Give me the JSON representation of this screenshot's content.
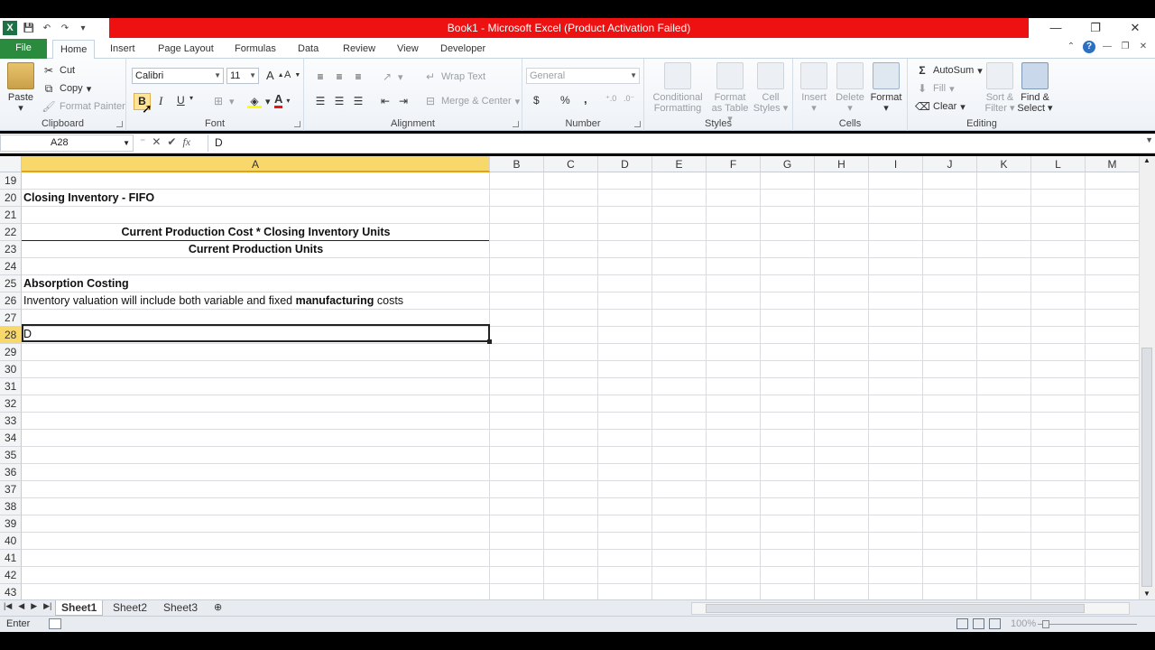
{
  "window": {
    "title": "Book1  -  Microsoft Excel (Product Activation Failed)",
    "title_bg": "#ee1111",
    "buttons": [
      "minimize",
      "restore",
      "close"
    ]
  },
  "ribbon": {
    "tabs": [
      "File",
      "Home",
      "Insert",
      "Page Layout",
      "Formulas",
      "Data",
      "Review",
      "View",
      "Developer"
    ],
    "active_tab": "Home",
    "clipboard": {
      "paste": "Paste",
      "cut": "Cut",
      "copy": "Copy",
      "format_painter": "Format Painter",
      "label": "Clipboard"
    },
    "font": {
      "name": "Calibri",
      "size": "11",
      "label": "Font",
      "bold": "B",
      "italic": "I",
      "underline": "U"
    },
    "alignment": {
      "wrap_text": "Wrap Text",
      "merge_center": "Merge & Center",
      "label": "Alignment"
    },
    "number": {
      "format": "General",
      "label": "Number",
      "currency": "$",
      "percent": "%",
      "comma": ","
    },
    "styles": {
      "conditional": "Conditional Formatting",
      "conditional_l1": "Conditional",
      "conditional_l2": "Formatting",
      "table_l1": "Format",
      "table_l2": "as Table",
      "cell_l1": "Cell",
      "cell_l2": "Styles",
      "label": "Styles"
    },
    "cells": {
      "insert": "Insert",
      "delete": "Delete",
      "format": "Format",
      "label": "Cells"
    },
    "editing": {
      "autosum": "AutoSum",
      "fill": "Fill",
      "clear": "Clear",
      "sort_l1": "Sort &",
      "sort_l2": "Filter",
      "find_l1": "Find &",
      "find_l2": "Select",
      "label": "Editing"
    }
  },
  "formula_bar": {
    "name_box": "A28",
    "cancel": "✕",
    "enter": "✔",
    "fx": "fx",
    "content": "D"
  },
  "grid": {
    "columns": [
      "A",
      "B",
      "C",
      "D",
      "E",
      "F",
      "G",
      "H",
      "I",
      "J",
      "K",
      "L",
      "M"
    ],
    "selected_column": "A",
    "rows": [
      "19",
      "20",
      "21",
      "22",
      "23",
      "24",
      "25",
      "26",
      "27",
      "28",
      "29",
      "30",
      "31",
      "32",
      "33",
      "34",
      "35",
      "36",
      "37",
      "38",
      "39",
      "40",
      "41",
      "42",
      "43"
    ],
    "selected_row": "28",
    "cells": {
      "A20": "Closing Inventory - FIFO",
      "A22": "Current Production Cost * Closing Inventory Units",
      "A23": "Current Production Units",
      "A25": "Absorption Costing",
      "A26_pre": "Inventory valuation will include both variable and fixed ",
      "A26_bold": "manufacturing",
      "A26_post": " costs",
      "A28": "D"
    }
  },
  "sheets": {
    "tabs": [
      "Sheet1",
      "Sheet2",
      "Sheet3"
    ],
    "active": "Sheet1"
  },
  "status": {
    "mode": "Enter",
    "zoom": "100%"
  }
}
